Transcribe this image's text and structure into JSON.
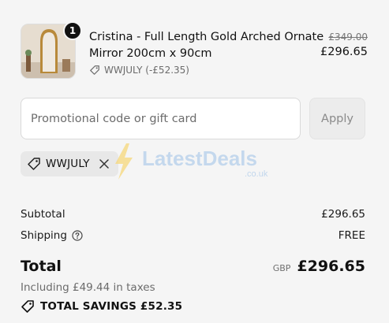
{
  "product": {
    "quantity": "1",
    "name": "Cristina - Full Length Gold Arched Ornate Mirror 200cm x 90cm",
    "discount_code": "WWJULY (-£52.35)",
    "original_price": "£349.00",
    "price": "£296.65"
  },
  "promo": {
    "placeholder": "Promotional code or gift card",
    "apply_label": "Apply",
    "applied_code": "WWJULY"
  },
  "watermark": {
    "brand": "LatestDeals",
    "domain": ".co.uk"
  },
  "summary": {
    "subtotal_label": "Subtotal",
    "subtotal_value": "£296.65",
    "shipping_label": "Shipping",
    "shipping_value": "FREE",
    "total_label": "Total",
    "currency": "GBP",
    "total_value": "£296.65",
    "taxes_text": "Including £49.44 in taxes",
    "savings_text": "TOTAL SAVINGS £52.35"
  }
}
